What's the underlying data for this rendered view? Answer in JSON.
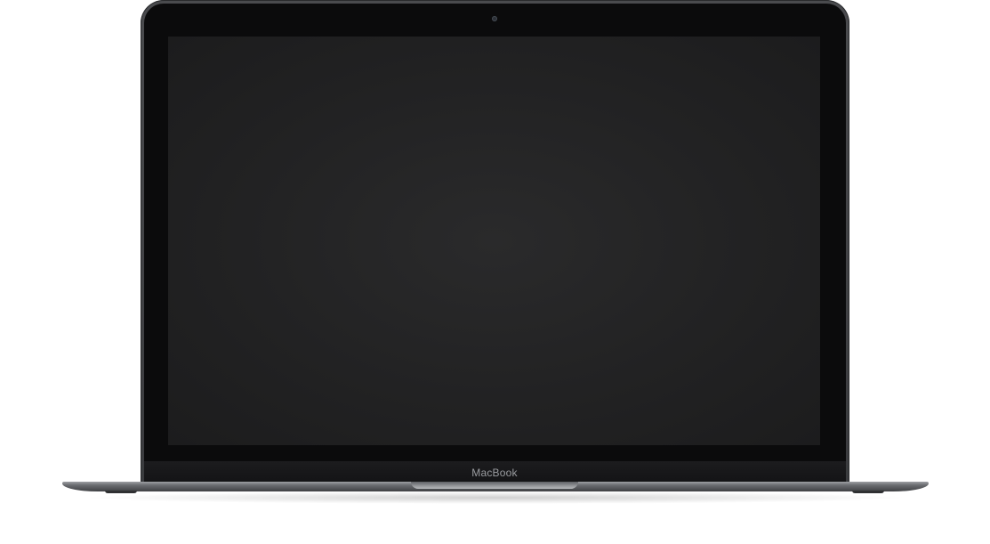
{
  "device": {
    "brand_label": "MacBook",
    "screen_state": "off"
  },
  "colors": {
    "screen": "#222223",
    "bezel": "#0b0b0c",
    "casing": "#4a4b4e",
    "logo_text": "#9a9ca0"
  }
}
